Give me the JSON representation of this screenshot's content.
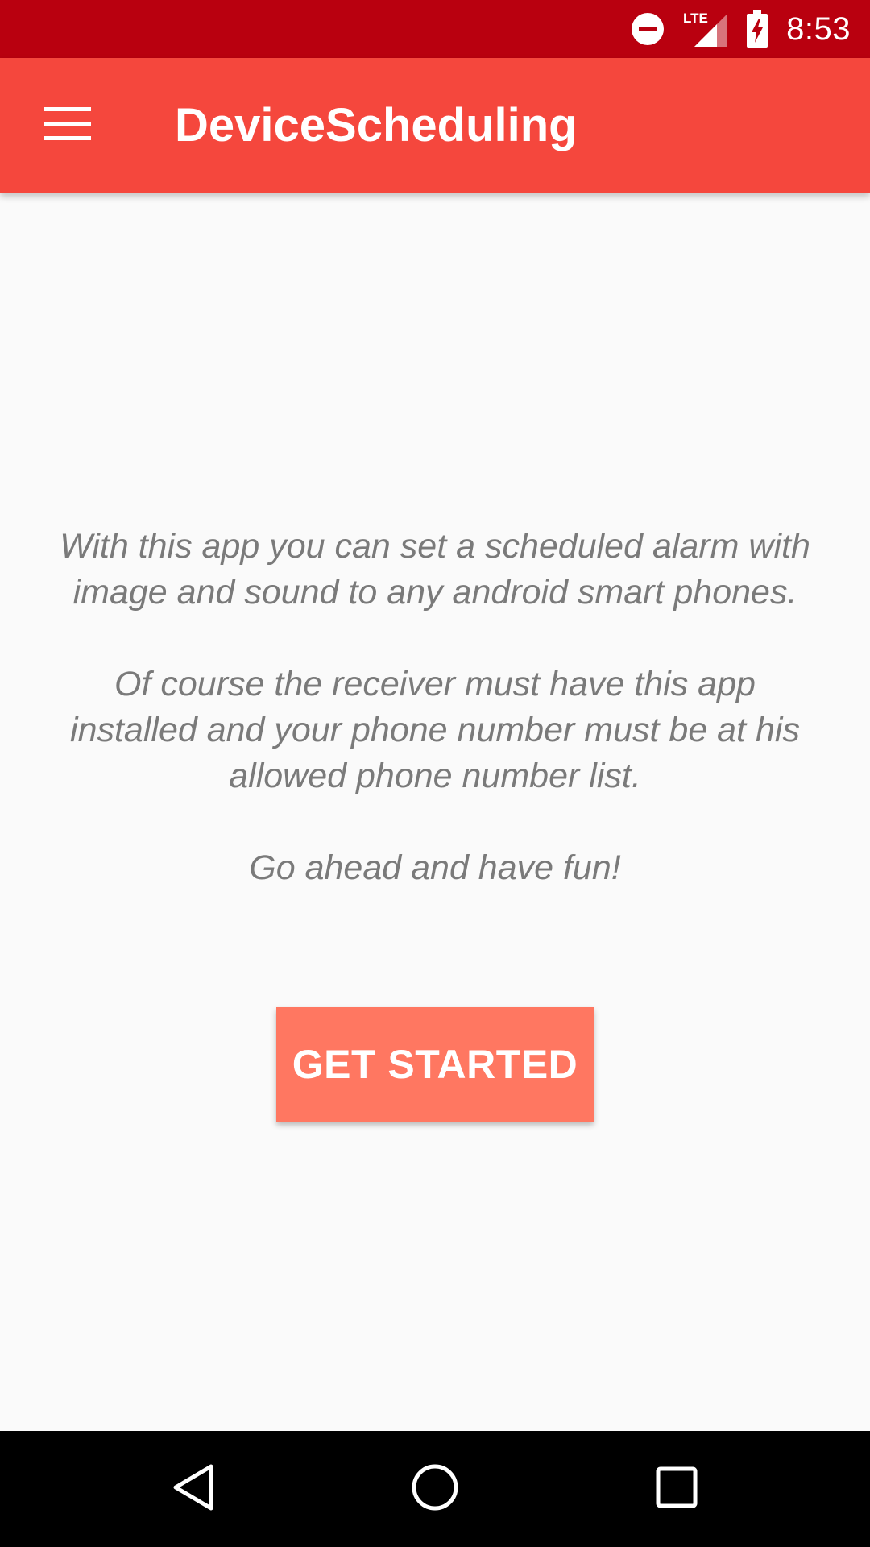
{
  "status_bar": {
    "background_color": "#b9000f",
    "icons": [
      "do-not-disturb-icon",
      "lte-signal-icon",
      "battery-charging-icon"
    ],
    "network_label": "LTE",
    "time": "8:53"
  },
  "app_bar": {
    "background_color": "#f5473d",
    "menu_icon": "hamburger-menu-icon",
    "title": "DeviceScheduling"
  },
  "main": {
    "paragraphs": [
      "With this app you can set a scheduled alarm with image and sound to any android smart phones.",
      "Of course the receiver must have this app installed and your phone number must be at his allowed phone number list.",
      "Go ahead and have fun!"
    ],
    "get_started_label": "GET STARTED",
    "button_color": "#ff7761"
  },
  "nav_bar": {
    "buttons": [
      "back-icon",
      "home-icon",
      "recents-icon"
    ]
  }
}
